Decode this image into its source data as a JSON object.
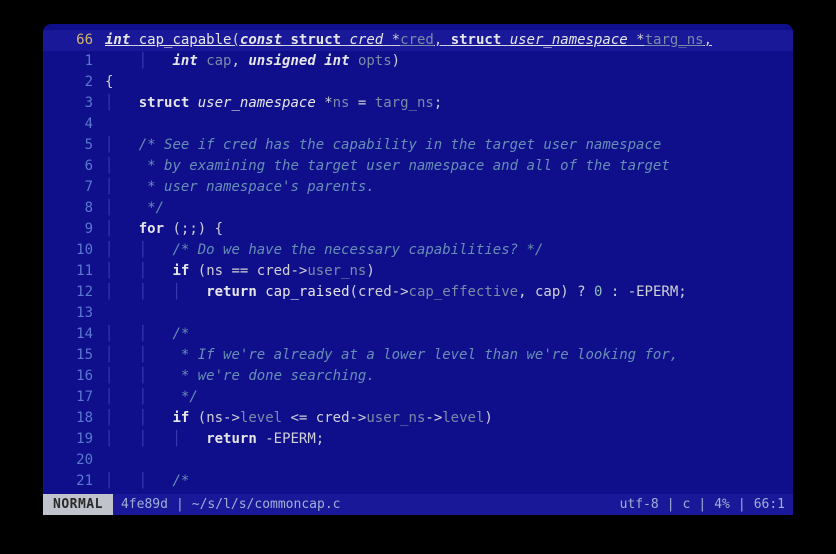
{
  "gutter": {
    "current": "66",
    "rel": [
      "1",
      "2",
      "3",
      "4",
      "5",
      "6",
      "7",
      "8",
      "9",
      "10",
      "11",
      "12",
      "13",
      "14",
      "15",
      "16",
      "17",
      "18",
      "19",
      "20",
      "21"
    ]
  },
  "sig": {
    "int": "int",
    "fn": "cap_capable",
    "const": "const",
    "struct1": "struct",
    "cred_t": "cred",
    "cred_p": "cred",
    "struct2": "struct",
    "un_t": "user_namespace",
    "targ": "targ_ns",
    "int2": "int",
    "cap": "cap",
    "unsigned": "unsigned",
    "int3": "int",
    "opts": "opts"
  },
  "body": {
    "lbrace": "{",
    "decl_struct": "struct",
    "decl_type": "user_namespace",
    "decl_var": "ns",
    "decl_eq": "=",
    "decl_rhs": "targ_ns",
    "c1": "/* See if cred has the capability in the target user namespace",
    "c2": " * by examining the target user namespace and all of the target",
    "c3": " * user namespace's parents.",
    "c4": " */",
    "for_kw": "for",
    "for_rest": "(;;) {",
    "c5": "/* Do we have the necessary capabilities? */",
    "if1_kw": "if",
    "if1_expr_a": "(ns == cred->",
    "if1_expr_b": "user_ns",
    "if1_expr_c": ")",
    "ret1_kw": "return",
    "ret1_fn": "cap_raised",
    "ret1_a": "(cred->",
    "ret1_b": "cap_effective",
    "ret1_c": ", cap) ? ",
    "ret1_d": "0",
    "ret1_e": " : -EPERM;",
    "c6": "/*",
    "c7": " * If we're already at a lower level than we're looking for,",
    "c8": " * we're done searching.",
    "c9": " */",
    "if2_kw": "if",
    "if2_expr_a": "(ns->",
    "if2_expr_b": "level",
    "if2_expr_c": " <= cred->",
    "if2_expr_d": "user_ns",
    "if2_expr_e": "->",
    "if2_expr_f": "level",
    "if2_expr_g": ")",
    "ret2_kw": "return",
    "ret2_rest": " -EPERM;",
    "c10": "/*"
  },
  "status": {
    "mode": "NORMAL",
    "sha": "4fe89d",
    "path": "~/s/l/s/commoncap.c",
    "enc": "utf-8",
    "ft": "c",
    "pct": "4%",
    "pos": "66:1"
  }
}
